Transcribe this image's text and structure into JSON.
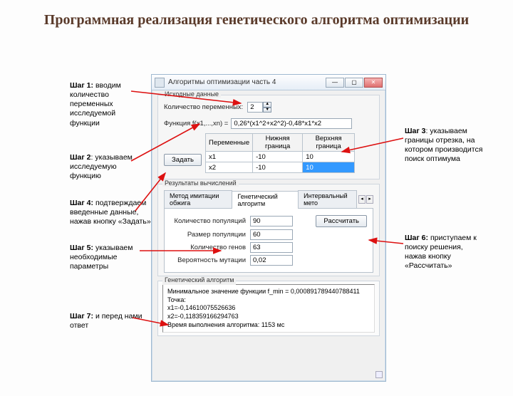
{
  "slide_title": "Программная реализация генетического алгоритма оптимизации",
  "steps": {
    "s1": {
      "bold": "Шаг 1:",
      "text": " вводим количество переменных исследуемой функции"
    },
    "s2": {
      "bold": "Шаг 2",
      "text": ": указываем исследуемую функцию"
    },
    "s3": {
      "bold": "Шаг 3",
      "text": ": указываем границы отрезка, на котором производится поиск оптимума"
    },
    "s4": {
      "bold": "Шаг 4:",
      "text": " подтверждаем введенные данные, нажав кнопку «Задать»"
    },
    "s5": {
      "bold": "Шаг 5:",
      "text": " указываем необходимые параметры"
    },
    "s6": {
      "bold": "Шаг 6:",
      "text": " приступаем к поиску решения, нажав кнопку «Рассчитать»"
    },
    "s7": {
      "bold": "Шаг 7:",
      "text": " и перед нами ответ"
    }
  },
  "window": {
    "title": "Алгоритмы оптимизации часть 4",
    "input_group": "Исходные данные",
    "var_count_label": "Количество переменных:",
    "var_count_value": "2",
    "func_label": "Функция f(x1,...,xn) =",
    "func_value": "0,26*(x1^2+x2^2)-0,48*x1*x2",
    "table": {
      "h1": "Переменные",
      "h2": "Нижняя граница",
      "h3": "Верхняя граница",
      "rows": [
        {
          "v": "x1",
          "lo": "-10",
          "hi": "10"
        },
        {
          "v": "x2",
          "lo": "-10",
          "hi": "10"
        }
      ]
    },
    "set_btn": "Задать",
    "results_group": "Результаты вычислений",
    "tabs": {
      "t1": "Метод имитации обжига",
      "t2": "Генетический алгоритм",
      "t3": "Интервальный мето"
    },
    "params": {
      "pop_count_label": "Количество популяций",
      "pop_count": "90",
      "pop_size_label": "Размер популяции",
      "pop_size": "60",
      "gene_count_label": "Количество генов",
      "gene_count": "63",
      "mut_prob_label": "Вероятность мутации",
      "mut_prob": "0,02"
    },
    "calc_btn": "Рассчитать",
    "result_title": "Генетический алгоритм",
    "result_lines": {
      "l1": "Минимальное значение функции f_min = 0,000891789440788411",
      "l2": "Точка:",
      "l3": "x1=-0,14610075526636",
      "l4": "x2=-0,118359166294763",
      "l5": "Время выполнения алгоритма: 1153 мс"
    }
  }
}
